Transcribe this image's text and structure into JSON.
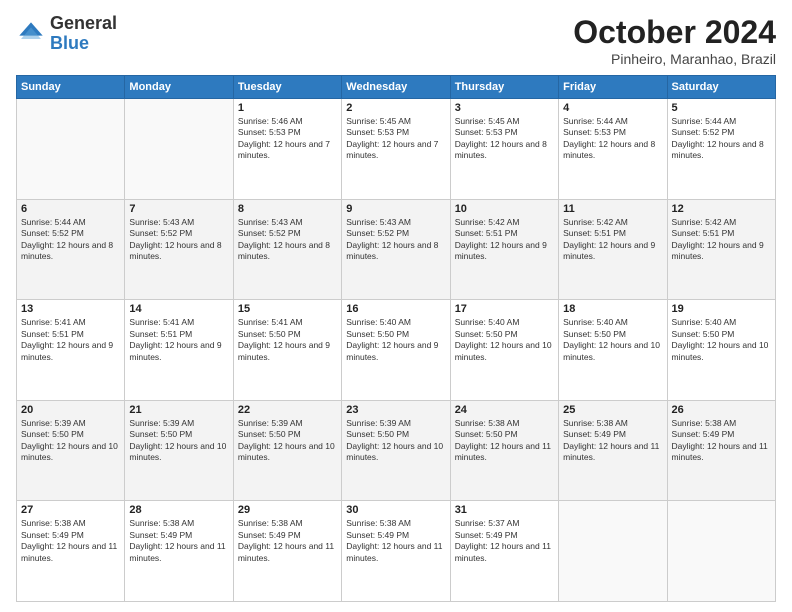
{
  "logo": {
    "text_general": "General",
    "text_blue": "Blue"
  },
  "header": {
    "month_year": "October 2024",
    "location": "Pinheiro, Maranhao, Brazil"
  },
  "days_of_week": [
    "Sunday",
    "Monday",
    "Tuesday",
    "Wednesday",
    "Thursday",
    "Friday",
    "Saturday"
  ],
  "weeks": [
    [
      {
        "day": "",
        "sunrise": "",
        "sunset": "",
        "daylight": ""
      },
      {
        "day": "",
        "sunrise": "",
        "sunset": "",
        "daylight": ""
      },
      {
        "day": "1",
        "sunrise": "Sunrise: 5:46 AM",
        "sunset": "Sunset: 5:53 PM",
        "daylight": "Daylight: 12 hours and 7 minutes."
      },
      {
        "day": "2",
        "sunrise": "Sunrise: 5:45 AM",
        "sunset": "Sunset: 5:53 PM",
        "daylight": "Daylight: 12 hours and 7 minutes."
      },
      {
        "day": "3",
        "sunrise": "Sunrise: 5:45 AM",
        "sunset": "Sunset: 5:53 PM",
        "daylight": "Daylight: 12 hours and 8 minutes."
      },
      {
        "day": "4",
        "sunrise": "Sunrise: 5:44 AM",
        "sunset": "Sunset: 5:53 PM",
        "daylight": "Daylight: 12 hours and 8 minutes."
      },
      {
        "day": "5",
        "sunrise": "Sunrise: 5:44 AM",
        "sunset": "Sunset: 5:52 PM",
        "daylight": "Daylight: 12 hours and 8 minutes."
      }
    ],
    [
      {
        "day": "6",
        "sunrise": "Sunrise: 5:44 AM",
        "sunset": "Sunset: 5:52 PM",
        "daylight": "Daylight: 12 hours and 8 minutes."
      },
      {
        "day": "7",
        "sunrise": "Sunrise: 5:43 AM",
        "sunset": "Sunset: 5:52 PM",
        "daylight": "Daylight: 12 hours and 8 minutes."
      },
      {
        "day": "8",
        "sunrise": "Sunrise: 5:43 AM",
        "sunset": "Sunset: 5:52 PM",
        "daylight": "Daylight: 12 hours and 8 minutes."
      },
      {
        "day": "9",
        "sunrise": "Sunrise: 5:43 AM",
        "sunset": "Sunset: 5:52 PM",
        "daylight": "Daylight: 12 hours and 8 minutes."
      },
      {
        "day": "10",
        "sunrise": "Sunrise: 5:42 AM",
        "sunset": "Sunset: 5:51 PM",
        "daylight": "Daylight: 12 hours and 9 minutes."
      },
      {
        "day": "11",
        "sunrise": "Sunrise: 5:42 AM",
        "sunset": "Sunset: 5:51 PM",
        "daylight": "Daylight: 12 hours and 9 minutes."
      },
      {
        "day": "12",
        "sunrise": "Sunrise: 5:42 AM",
        "sunset": "Sunset: 5:51 PM",
        "daylight": "Daylight: 12 hours and 9 minutes."
      }
    ],
    [
      {
        "day": "13",
        "sunrise": "Sunrise: 5:41 AM",
        "sunset": "Sunset: 5:51 PM",
        "daylight": "Daylight: 12 hours and 9 minutes."
      },
      {
        "day": "14",
        "sunrise": "Sunrise: 5:41 AM",
        "sunset": "Sunset: 5:51 PM",
        "daylight": "Daylight: 12 hours and 9 minutes."
      },
      {
        "day": "15",
        "sunrise": "Sunrise: 5:41 AM",
        "sunset": "Sunset: 5:50 PM",
        "daylight": "Daylight: 12 hours and 9 minutes."
      },
      {
        "day": "16",
        "sunrise": "Sunrise: 5:40 AM",
        "sunset": "Sunset: 5:50 PM",
        "daylight": "Daylight: 12 hours and 9 minutes."
      },
      {
        "day": "17",
        "sunrise": "Sunrise: 5:40 AM",
        "sunset": "Sunset: 5:50 PM",
        "daylight": "Daylight: 12 hours and 10 minutes."
      },
      {
        "day": "18",
        "sunrise": "Sunrise: 5:40 AM",
        "sunset": "Sunset: 5:50 PM",
        "daylight": "Daylight: 12 hours and 10 minutes."
      },
      {
        "day": "19",
        "sunrise": "Sunrise: 5:40 AM",
        "sunset": "Sunset: 5:50 PM",
        "daylight": "Daylight: 12 hours and 10 minutes."
      }
    ],
    [
      {
        "day": "20",
        "sunrise": "Sunrise: 5:39 AM",
        "sunset": "Sunset: 5:50 PM",
        "daylight": "Daylight: 12 hours and 10 minutes."
      },
      {
        "day": "21",
        "sunrise": "Sunrise: 5:39 AM",
        "sunset": "Sunset: 5:50 PM",
        "daylight": "Daylight: 12 hours and 10 minutes."
      },
      {
        "day": "22",
        "sunrise": "Sunrise: 5:39 AM",
        "sunset": "Sunset: 5:50 PM",
        "daylight": "Daylight: 12 hours and 10 minutes."
      },
      {
        "day": "23",
        "sunrise": "Sunrise: 5:39 AM",
        "sunset": "Sunset: 5:50 PM",
        "daylight": "Daylight: 12 hours and 10 minutes."
      },
      {
        "day": "24",
        "sunrise": "Sunrise: 5:38 AM",
        "sunset": "Sunset: 5:50 PM",
        "daylight": "Daylight: 12 hours and 11 minutes."
      },
      {
        "day": "25",
        "sunrise": "Sunrise: 5:38 AM",
        "sunset": "Sunset: 5:49 PM",
        "daylight": "Daylight: 12 hours and 11 minutes."
      },
      {
        "day": "26",
        "sunrise": "Sunrise: 5:38 AM",
        "sunset": "Sunset: 5:49 PM",
        "daylight": "Daylight: 12 hours and 11 minutes."
      }
    ],
    [
      {
        "day": "27",
        "sunrise": "Sunrise: 5:38 AM",
        "sunset": "Sunset: 5:49 PM",
        "daylight": "Daylight: 12 hours and 11 minutes."
      },
      {
        "day": "28",
        "sunrise": "Sunrise: 5:38 AM",
        "sunset": "Sunset: 5:49 PM",
        "daylight": "Daylight: 12 hours and 11 minutes."
      },
      {
        "day": "29",
        "sunrise": "Sunrise: 5:38 AM",
        "sunset": "Sunset: 5:49 PM",
        "daylight": "Daylight: 12 hours and 11 minutes."
      },
      {
        "day": "30",
        "sunrise": "Sunrise: 5:38 AM",
        "sunset": "Sunset: 5:49 PM",
        "daylight": "Daylight: 12 hours and 11 minutes."
      },
      {
        "day": "31",
        "sunrise": "Sunrise: 5:37 AM",
        "sunset": "Sunset: 5:49 PM",
        "daylight": "Daylight: 12 hours and 11 minutes."
      },
      {
        "day": "",
        "sunrise": "",
        "sunset": "",
        "daylight": ""
      },
      {
        "day": "",
        "sunrise": "",
        "sunset": "",
        "daylight": ""
      }
    ]
  ]
}
